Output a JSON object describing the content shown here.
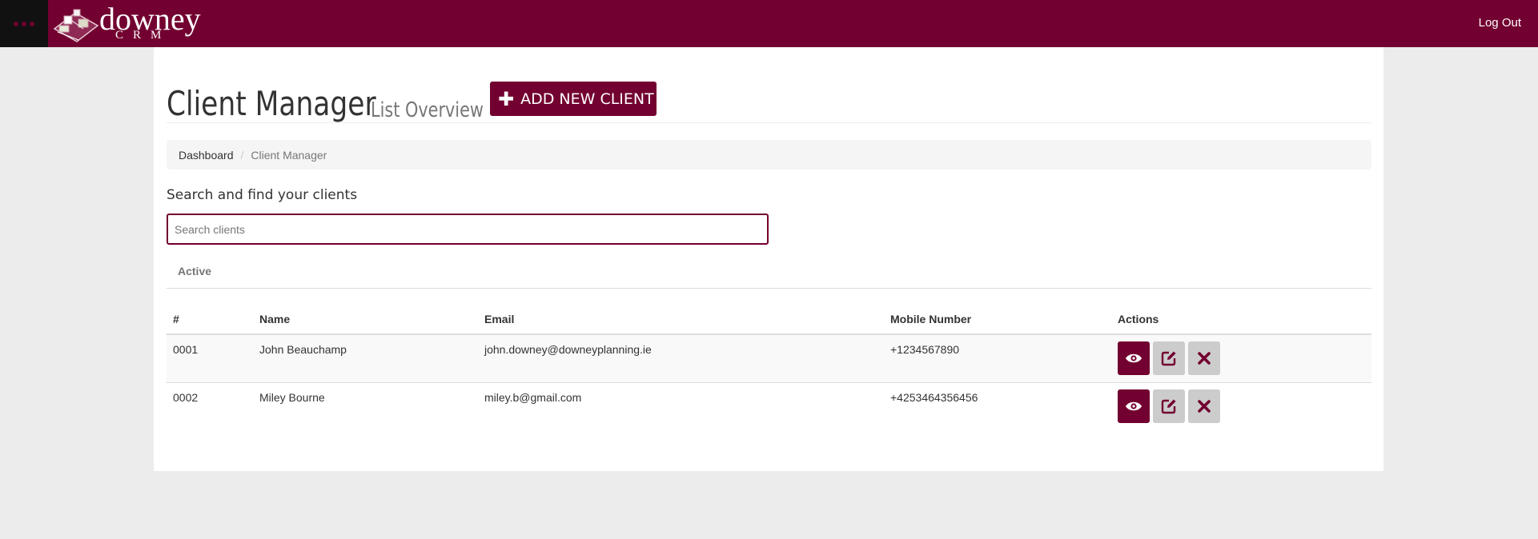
{
  "app": {
    "logo_word": "downey",
    "logo_sub": "CRM",
    "logout_label": "Log Out"
  },
  "page": {
    "title": "Client Manager",
    "subtitle": "List Overview",
    "add_button_label": "ADD NEW CLIENT"
  },
  "breadcrumb": {
    "items": [
      "Dashboard",
      "Client Manager"
    ]
  },
  "search": {
    "label": "Search and find your clients",
    "placeholder": "Search clients",
    "value": ""
  },
  "tabs": {
    "active_label": "Active"
  },
  "table": {
    "headers": [
      "#",
      "Name",
      "Email",
      "Mobile Number",
      "Actions"
    ],
    "rows": [
      {
        "id": "0001",
        "name": "John Beauchamp",
        "email": "john.downey@downeyplanning.ie",
        "mobile": "+1234567890"
      },
      {
        "id": "0002",
        "name": "Miley Bourne",
        "email": "miley.b@gmail.com",
        "mobile": "+4253464356456"
      }
    ]
  },
  "icons": {
    "menu": "menu-dots-icon",
    "plus": "plus-icon",
    "view": "eye-icon",
    "edit": "edit-icon",
    "delete": "close-icon"
  },
  "colors": {
    "brand": "#720030",
    "menu_bg": "#111111",
    "page_bg": "#ececec",
    "action_grey": "#cccccc"
  }
}
